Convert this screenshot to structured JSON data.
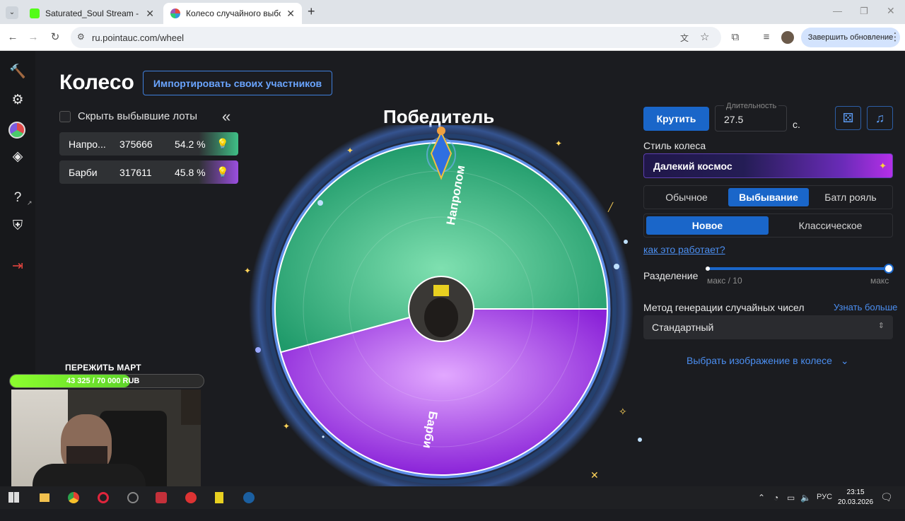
{
  "browser": {
    "tabs": [
      {
        "title": "Saturated_Soul Stream - Watch",
        "favicon_color": "#53fc18"
      },
      {
        "title": "Колесо случайного выбора – Р",
        "favicon_color": "#8a6bd8"
      }
    ],
    "new_tab": "+",
    "url": "ru.pointauc.com/wheel",
    "update_button": "Завершить обновление"
  },
  "page": {
    "title": "Колесо",
    "import_button": "Импортировать своих участников",
    "hide_label": "Скрыть выбывшие лоты",
    "collapse": "«",
    "lots": [
      {
        "name": "Напро...",
        "amount": "375666",
        "percent": "54.2 %",
        "color": "#3fbf86"
      },
      {
        "name": "Барби",
        "amount": "317611",
        "percent": "45.8 %",
        "color": "#9b4ee0"
      }
    ],
    "winner_label": "Победитель",
    "wheel": {
      "segments": [
        {
          "label": "Напролом",
          "fraction": 0.542,
          "color": "#3fbf86"
        },
        {
          "label": "Барби",
          "fraction": 0.458,
          "color": "#a13ce8"
        }
      ]
    }
  },
  "controls": {
    "spin_button": "Крутить",
    "duration_label": "Длительность",
    "duration_value": "27.5",
    "duration_unit": "с.",
    "style_label": "Стиль колеса",
    "style_value": "Далекий космос",
    "modes": [
      "Обычное",
      "Выбывание",
      "Батл рояль"
    ],
    "active_mode": "Выбывание",
    "variants": [
      "Новое",
      "Классическое"
    ],
    "active_variant": "Новое",
    "how_link": "как это работает?",
    "split_label": "Разделение",
    "split_min": "макс / 10",
    "split_max": "макс",
    "split_value_fraction": 1.0,
    "rng_label": "Метод генерации случайных чисел",
    "rng_more": "Узнать больше",
    "rng_value": "Стандартный",
    "image_link": "Выбрать изображение в колесе"
  },
  "overlay": {
    "title": "ПЕРЕЖИТЬ МАРТ",
    "goal_text": "43 325 / 70 000 RUB",
    "goal_fraction": 0.619
  },
  "taskbar": {
    "lang": "РУС",
    "time": "23:15",
    "date": "20.03.2026"
  }
}
